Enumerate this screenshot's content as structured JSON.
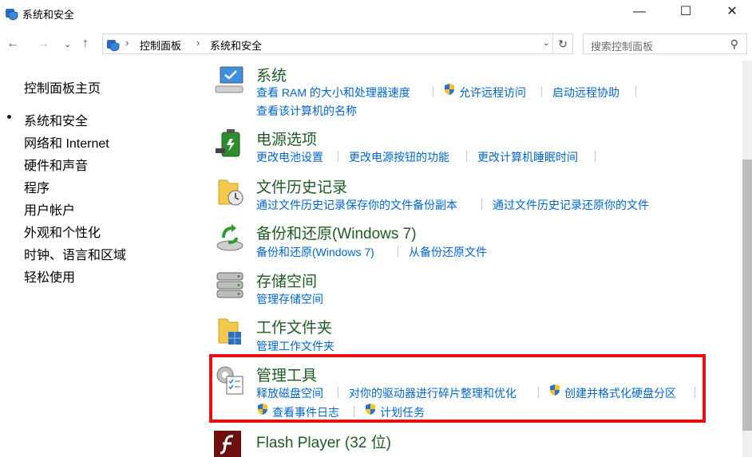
{
  "window": {
    "title": "系统和安全"
  },
  "address": {
    "crumbs": [
      "控制面板",
      "系统和安全"
    ]
  },
  "search": {
    "placeholder": "搜索控制面板"
  },
  "nav": {
    "home": "控制面板主页",
    "items": [
      "系统和安全",
      "网络和 Internet",
      "硬件和声音",
      "程序",
      "用户帐户",
      "外观和个性化",
      "时钟、语言和区域",
      "轻松使用"
    ]
  },
  "sections": [
    {
      "title": "系统",
      "links": [
        "查看 RAM 的大小和处理器速度",
        "允许远程访问",
        "启动远程协助",
        "查看该计算机的名称"
      ]
    },
    {
      "title": "电源选项",
      "links": [
        "更改电池设置",
        "更改电源按钮的功能",
        "更改计算机睡眠时间"
      ]
    },
    {
      "title": "文件历史记录",
      "links": [
        "通过文件历史记录保存你的文件备份副本",
        "通过文件历史记录还原你的文件"
      ]
    },
    {
      "title": "备份和还原(Windows 7)",
      "links": [
        "备份和还原(Windows 7)",
        "从备份还原文件"
      ]
    },
    {
      "title": "存储空间",
      "links": [
        "管理存储空间"
      ]
    },
    {
      "title": "工作文件夹",
      "links": [
        "管理工作文件夹"
      ]
    },
    {
      "title": "管理工具",
      "links": [
        "释放磁盘空间",
        "对你的驱动器进行碎片整理和优化",
        "创建并格式化硬盘分区",
        "查看事件日志",
        "计划任务"
      ]
    },
    {
      "title": "Flash Player (32 位)",
      "links": []
    }
  ],
  "colors": {
    "heading": "#1e5a24",
    "link": "#0066cc",
    "highlight": "#e81010"
  }
}
